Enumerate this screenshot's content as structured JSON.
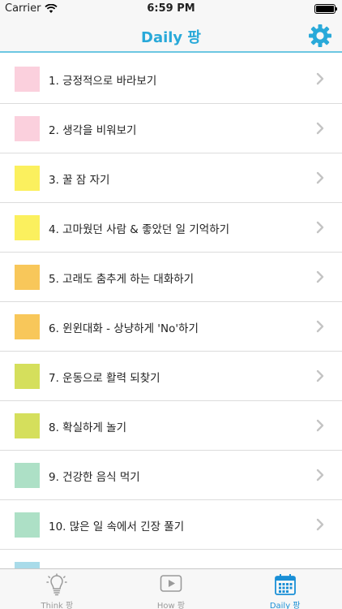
{
  "status_bar": {
    "carrier": "Carrier",
    "time": "6:59 PM"
  },
  "nav": {
    "title": "Daily 팡"
  },
  "colors": {
    "accent": "#29a9d9",
    "tab_active": "#1a8fd6",
    "tab_inactive": "#9a9a9a"
  },
  "items": [
    {
      "label": "1. 긍정적으로 바라보기",
      "color": "#fbd0dd"
    },
    {
      "label": "2. 생각을 비워보기",
      "color": "#fbd0dd"
    },
    {
      "label": "3. 꿀 잠 자기",
      "color": "#fbf05e"
    },
    {
      "label": "4. 고마웠던 사람 & 좋았던 일 기억하기",
      "color": "#fbf05e"
    },
    {
      "label": "5. 고래도 춤추게 하는 대화하기",
      "color": "#f8c75a"
    },
    {
      "label": "6. 윈윈대화 - 상냥하게 'No'하기",
      "color": "#f8c75a"
    },
    {
      "label": "7. 운동으로 활력 되찾기",
      "color": "#d5df5c"
    },
    {
      "label": "8. 확실하게 놀기",
      "color": "#d5df5c"
    },
    {
      "label": "9. 건강한 음식 먹기",
      "color": "#ade0c6"
    },
    {
      "label": "10. 많은 일 속에서 긴장 풀기",
      "color": "#ade0c6"
    },
    {
      "label": "",
      "color": "#a9dbe9"
    }
  ],
  "tabs": [
    {
      "label": "Think 팡",
      "icon": "lightbulb-icon",
      "active": false
    },
    {
      "label": "How 팡",
      "icon": "play-icon",
      "active": false
    },
    {
      "label": "Daily 팡",
      "icon": "calendar-icon",
      "active": true
    }
  ]
}
